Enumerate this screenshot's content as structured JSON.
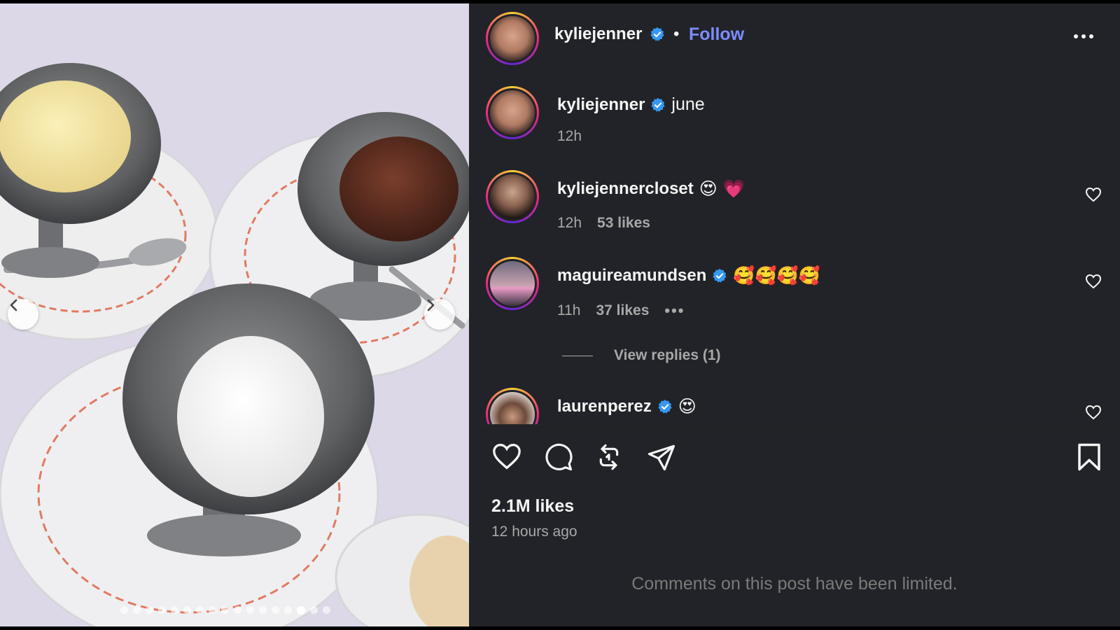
{
  "post": {
    "author": "kyliejenner",
    "follow_label": "Follow",
    "separator": "•",
    "caption": "june",
    "caption_time": "12h",
    "likes": "2.1M likes",
    "posted": "12 hours ago",
    "comments_limited": "Comments on this post have been limited.",
    "carousel": {
      "total_slides": 17,
      "active_slide": 15
    }
  },
  "comments": [
    {
      "user": "kyliejennercloset",
      "verified": false,
      "text": "😍 💗",
      "time": "12h",
      "likes": "53 likes"
    },
    {
      "user": "maguireamundsen",
      "verified": true,
      "text": "🥰🥰🥰🥰",
      "time": "11h",
      "likes": "37 likes",
      "more": "•••"
    },
    {
      "user": "laurenperez",
      "verified": true,
      "text": "😍"
    }
  ],
  "replies": {
    "label": "View replies (1)"
  },
  "colors": {
    "panel_bg": "#212328",
    "follow": "#7d8cff",
    "verified": "#3897f0",
    "secondary": "#a8a8a8"
  }
}
